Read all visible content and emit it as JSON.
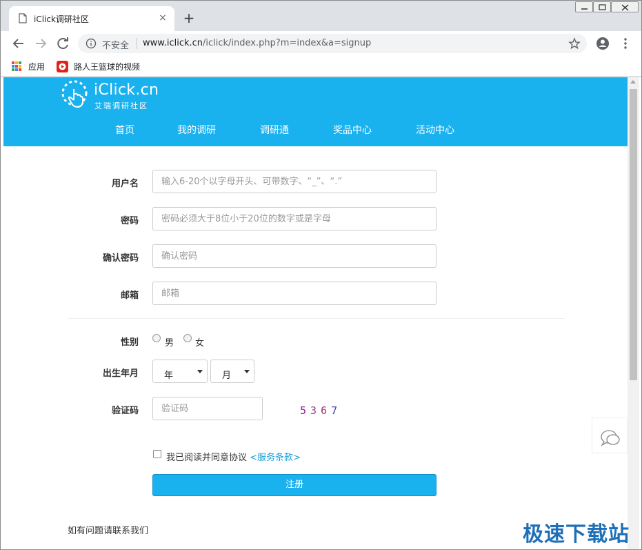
{
  "browser": {
    "tab_title": "iClick调研社区",
    "tab_close": "×",
    "new_tab": "+",
    "security_text": "不安全",
    "url_host": "www.iclick.cn",
    "url_path": "/iclick/index.php?m=index&a=signup",
    "bookmarks": [
      {
        "label": "应用",
        "icon": "apps-grid-icon"
      },
      {
        "label": "路人王篮球的视频",
        "icon": "video-icon"
      }
    ]
  },
  "site": {
    "logo_text": "iClick.cn",
    "logo_sub": "艾瑞调研社区",
    "nav": [
      "首页",
      "我的调研",
      "调研通",
      "奖品中心",
      "活动中心"
    ],
    "brand_color": "#1ab1ef"
  },
  "form": {
    "username": {
      "label": "用户名",
      "placeholder": "输入6-20个以字母开头、可带数字、“_”、“.”"
    },
    "password": {
      "label": "密码",
      "placeholder": "密码必须大于8位小于20位的数字或是字母"
    },
    "confirm": {
      "label": "确认密码",
      "placeholder": "确认密码"
    },
    "email": {
      "label": "邮箱",
      "placeholder": "邮箱"
    },
    "gender": {
      "label": "性别",
      "options": [
        "男",
        "女"
      ]
    },
    "birth": {
      "label": "出生年月",
      "year": "年",
      "month": "月"
    },
    "captcha": {
      "label": "验证码",
      "placeholder": "验证码",
      "digits": [
        "5",
        "3",
        "6",
        "7"
      ],
      "colors": [
        "#8b1a8b",
        "#9b3b9b",
        "#a0306a",
        "#3b3bb0"
      ]
    },
    "agree_text": "我已阅读并同意协议",
    "terms_link": "<服务条款>",
    "submit": "注册"
  },
  "footer": {
    "contact": "如有问题请联系我们"
  },
  "watermark": "极速下载站"
}
